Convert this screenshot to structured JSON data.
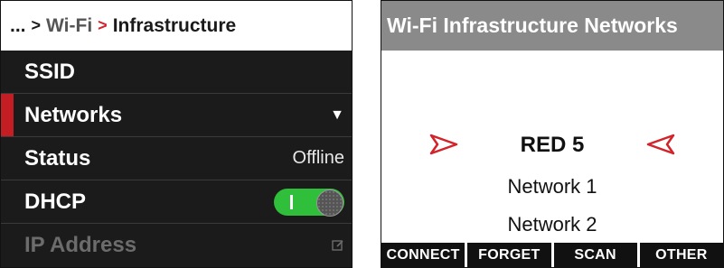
{
  "left_screen": {
    "breadcrumb": {
      "ellipsis": "...",
      "sep1": ">",
      "item1": "Wi-Fi",
      "sep2": ">",
      "current": "Infrastructure"
    },
    "menu": [
      {
        "label": "SSID",
        "value": ""
      },
      {
        "label": "Networks",
        "value": "",
        "selected": true,
        "icon": "chevron-down-icon"
      },
      {
        "label": "Status",
        "value": "Offline"
      },
      {
        "label": "DHCP",
        "toggle_on": true
      },
      {
        "label": "IP Address",
        "disabled": true,
        "icon": "edit-icon"
      }
    ],
    "colors": {
      "accent": "#c41e24",
      "toggle_on": "#2fbf3a"
    }
  },
  "right_screen": {
    "title": "Wi-Fi Infrastructure Networks",
    "networks": [
      "RED 5",
      "Network 1",
      "Network 2"
    ],
    "selector_icons": [
      "arrow-right-icon",
      "arrow-left-icon"
    ],
    "softkeys": [
      "CONNECT",
      "FORGET",
      "SCAN",
      "OTHER"
    ],
    "colors": {
      "header_bg": "#8a8a8a",
      "arrow": "#d2232a"
    }
  }
}
